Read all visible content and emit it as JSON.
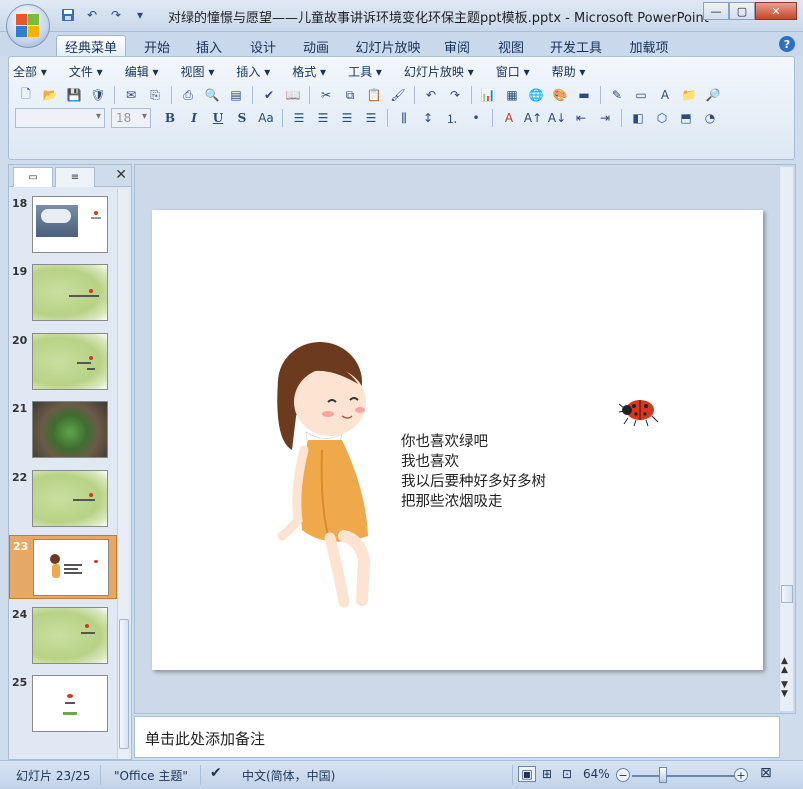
{
  "window": {
    "title": "对绿的憧憬与愿望——儿童故事讲诉环境变化环保主题ppt模板.pptx - Microsoft PowerPoint",
    "minimize": "—",
    "restore": "▢",
    "close": "✕"
  },
  "quick_access": {
    "save_icon": "save-icon",
    "undo_icon": "undo-icon",
    "redo_icon": "redo-icon",
    "customize": "▾"
  },
  "ribbon_tabs": [
    "经典菜单",
    "开始",
    "插入",
    "设计",
    "动画",
    "幻灯片放映",
    "审阅",
    "视图",
    "开发工具",
    "加载项"
  ],
  "active_tab": "经典菜单",
  "menu": [
    "全部 ▾",
    "文件 ▾",
    "编辑 ▾",
    "视图 ▾",
    "插入 ▾",
    "格式 ▾",
    "工具 ▾",
    "幻灯片放映 ▾",
    "窗口 ▾",
    "帮助 ▾"
  ],
  "format_bar": {
    "font_name": "",
    "font_size": "18"
  },
  "left_panel": {
    "tab_slides_icon": "slides-icon",
    "tab_outline_icon": "outline-icon",
    "close": "✕",
    "slides": [
      {
        "number": "18",
        "kind": "photo"
      },
      {
        "number": "19",
        "kind": "green"
      },
      {
        "number": "20",
        "kind": "green"
      },
      {
        "number": "21",
        "kind": "hands"
      },
      {
        "number": "22",
        "kind": "green"
      },
      {
        "number": "23",
        "kind": "girl",
        "selected": true
      },
      {
        "number": "24",
        "kind": "green"
      },
      {
        "number": "25",
        "kind": "white"
      }
    ]
  },
  "slide": {
    "text_lines": [
      "你也喜欢绿吧",
      "我也喜欢",
      "我以后要种好多好多树",
      "把那些浓烟吸走"
    ]
  },
  "notes": {
    "placeholder": "单击此处添加备注"
  },
  "status": {
    "slide_indicator": "幻灯片 23/25",
    "theme": "\"Office 主题\"",
    "language": "中文(简体，中国)",
    "zoom": "64%",
    "zoom_out": "−",
    "zoom_in": "+"
  },
  "colors": {
    "ribbon_bg": "#dde8f4",
    "selected_slide": "#e6a867",
    "girl_hair": "#6b3a1f",
    "girl_dress": "#f0a94a",
    "ladybug": "#d9361f"
  }
}
